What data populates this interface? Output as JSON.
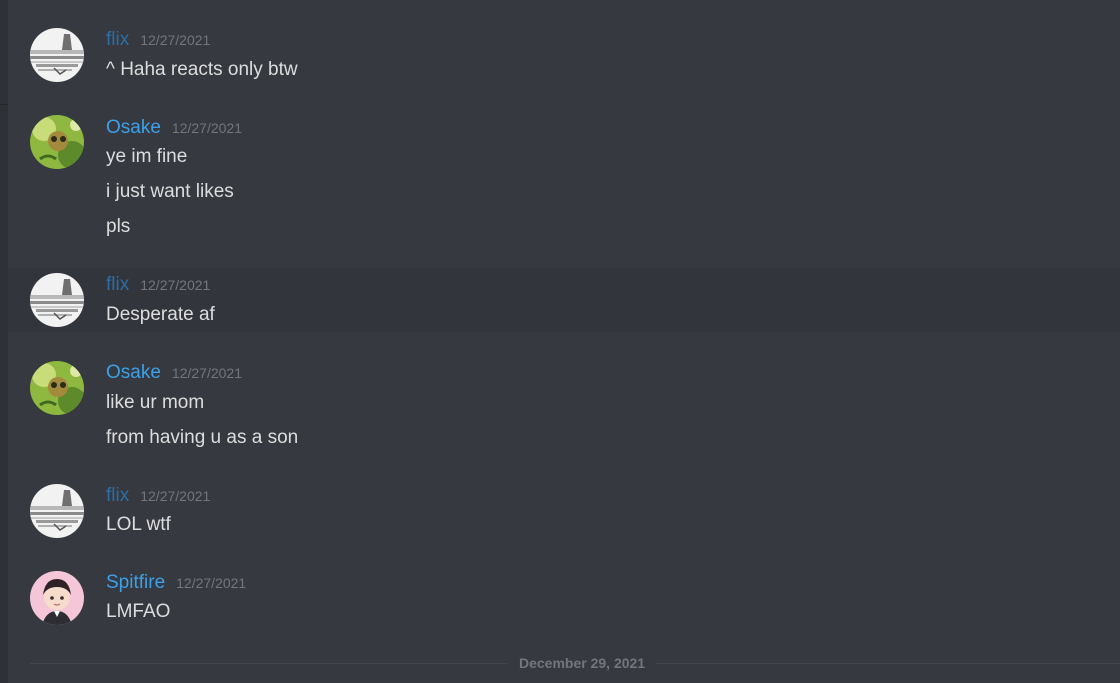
{
  "messages": [
    {
      "author": "flix",
      "author_color": "#2a6fa8",
      "timestamp": "12/27/2021",
      "avatar_icon": "sketch-landscape-avatar-icon",
      "lines": [
        "^ Haha reacts only btw"
      ]
    },
    {
      "author": "Osake",
      "author_color": "#3ca1e8",
      "timestamp": "12/27/2021",
      "avatar_icon": "green-creature-avatar-icon",
      "lines": [
        "ye im fine",
        "i just want likes",
        "pls"
      ]
    },
    {
      "author": "flix",
      "author_color": "#2a6fa8",
      "timestamp": "12/27/2021",
      "avatar_icon": "sketch-landscape-avatar-icon",
      "lines": [
        "Desperate af"
      ]
    },
    {
      "author": "Osake",
      "author_color": "#3ca1e8",
      "timestamp": "12/27/2021",
      "avatar_icon": "green-creature-avatar-icon",
      "lines": [
        "like ur mom",
        "from having u as a son"
      ]
    },
    {
      "author": "flix",
      "author_color": "#2a6fa8",
      "timestamp": "12/27/2021",
      "avatar_icon": "sketch-landscape-avatar-icon",
      "lines": [
        "LOL wtf"
      ]
    },
    {
      "author": "Spitfire",
      "author_color": "#3ca1e8",
      "timestamp": "12/27/2021",
      "avatar_icon": "anime-character-avatar-icon",
      "lines": [
        "LMFAO"
      ]
    }
  ],
  "date_divider": {
    "label": "December 29, 2021"
  }
}
